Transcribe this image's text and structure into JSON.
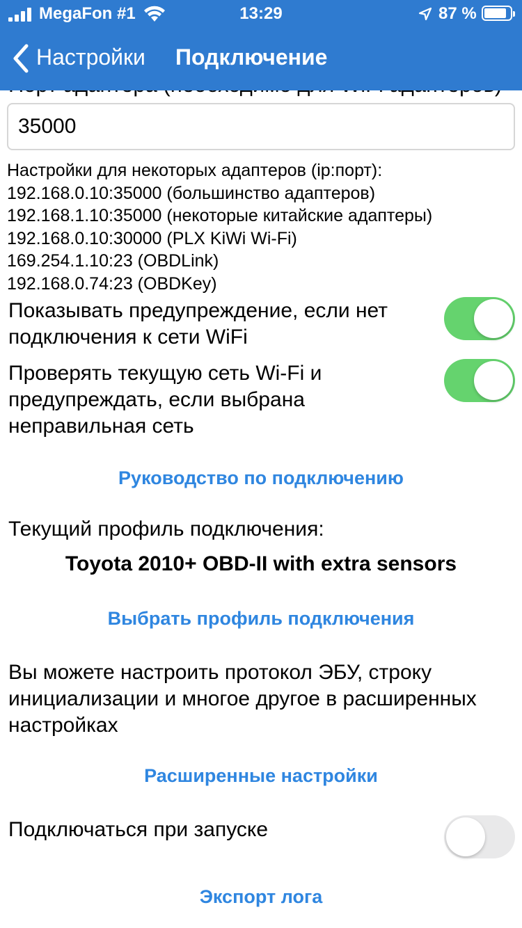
{
  "status_bar": {
    "carrier": "MegaFon #1",
    "time": "13:29",
    "battery_percent": "87 %",
    "battery_level": 0.87
  },
  "nav": {
    "back_label": "Настройки",
    "title": "Подключение"
  },
  "port_field": {
    "label": "Порт адаптера (необходимо для WiFi адаптеров)",
    "value": "35000"
  },
  "hint_lines": [
    "Настройки для некоторых адаптеров (ip:порт):",
    "192.168.0.10:35000 (большинство адаптеров)",
    "192.168.1.10:35000 (некоторые китайские адаптеры)",
    "192.168.0.10:30000 (PLX KiWi Wi-Fi)",
    "169.254.1.10:23 (OBDLink)",
    "192.168.0.74:23 (OBDKey)"
  ],
  "settings": {
    "warn_no_wifi": {
      "label": "Показывать предупреждение, если нет подключения к сети WiFi",
      "on": true
    },
    "check_network": {
      "label": "Проверять текущую сеть Wi-Fi и предупреждать, если выбрана неправильная сеть",
      "on": true
    },
    "connect_on_start": {
      "label": "Подключаться при запуске",
      "on": false
    }
  },
  "links": {
    "guide": "Руководство по подключению",
    "choose_profile": "Выбрать профиль подключения",
    "advanced": "Расширенные настройки",
    "export_log": "Экспорт лога"
  },
  "profile": {
    "heading": "Текущий профиль подключения:",
    "name": "Toyota 2010+ OBD-II with extra sensors"
  },
  "advanced_info": "Вы можете настроить протокол ЭБУ, строку инициализации и многое другое в расширенных настройках",
  "colors": {
    "nav_bar": "#2f7bd0",
    "link": "#2f86e0",
    "toggle_on": "#65d36e",
    "toggle_off": "#e9e9ea"
  }
}
